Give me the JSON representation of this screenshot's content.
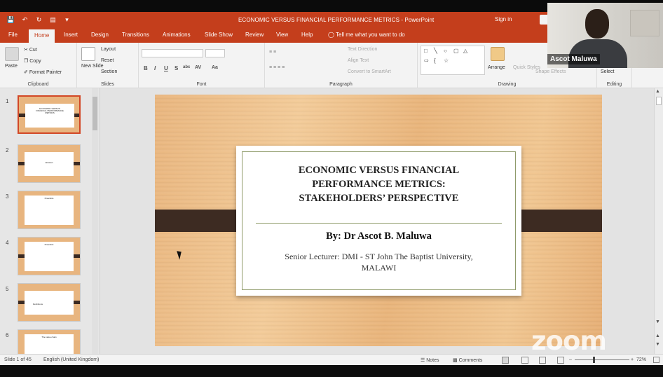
{
  "window": {
    "title": "ECONOMIC VERSUS FINANCIAL PERFORMANCE METRICS  -  PowerPoint",
    "account": "Sign in"
  },
  "tabs": [
    "File",
    "Home",
    "Insert",
    "Design",
    "Transitions",
    "Animations",
    "Slide Show",
    "Review",
    "View",
    "Help"
  ],
  "active_tab": "Home",
  "tell_me": "Tell me what you want to do",
  "ribbon": {
    "clipboard": {
      "paste": "Paste",
      "cut": "Cut",
      "copy": "Copy",
      "format_painter": "Format Painter",
      "label": "Clipboard"
    },
    "slides": {
      "new_slide": "New Slide",
      "layout": "Layout",
      "reset": "Reset",
      "section": "Section",
      "label": "Slides"
    },
    "font": {
      "label": "Font",
      "bold": "B",
      "italic": "I",
      "underline": "U",
      "strike": "S",
      "shadow": "abc",
      "spacing": "AV",
      "case": "Aa"
    },
    "paragraph": {
      "text_direction": "Text Direction",
      "align_text": "Align Text",
      "smartart": "Convert to SmartArt",
      "label": "Paragraph"
    },
    "drawing": {
      "arrange": "Arrange",
      "quick_styles": "Quick Styles",
      "shape_effects": "Shape Effects",
      "label": "Drawing"
    },
    "editing": {
      "select": "Select",
      "label": "Editing"
    }
  },
  "participant": {
    "name": "Ascot Maluwa"
  },
  "thumbnails": [
    {
      "num": "1",
      "text": "ECONOMIC VERSUS FINANCIAL PERFORMANCE METRICS"
    },
    {
      "num": "2",
      "text": "Abstract"
    },
    {
      "num": "3",
      "text": "Preamble"
    },
    {
      "num": "4",
      "text": "Preamble"
    },
    {
      "num": "5",
      "text": "Definitions"
    },
    {
      "num": "6",
      "text": "The value chain"
    }
  ],
  "slide": {
    "title_lines": [
      "ECONOMIC VERSUS FINANCIAL",
      "PERFORMANCE METRICS:",
      "STAKEHOLDERS’ PERSPECTIVE"
    ],
    "byline": "By: Dr  Ascot B. Maluwa",
    "subtitle_lines": [
      "Senior Lecturer: DMI - ST John The Baptist University,",
      "MALAWI"
    ]
  },
  "watermark": "zoom",
  "status": {
    "slide_count": "Slide 1 of 45",
    "language": "English (United Kingdom)",
    "notes": "Notes",
    "comments": "Comments",
    "zoom": "72%"
  },
  "colors": {
    "ribbon_accent": "#c43e1c",
    "bar": "#3d2b22",
    "slide_bg": "#ecb880"
  }
}
